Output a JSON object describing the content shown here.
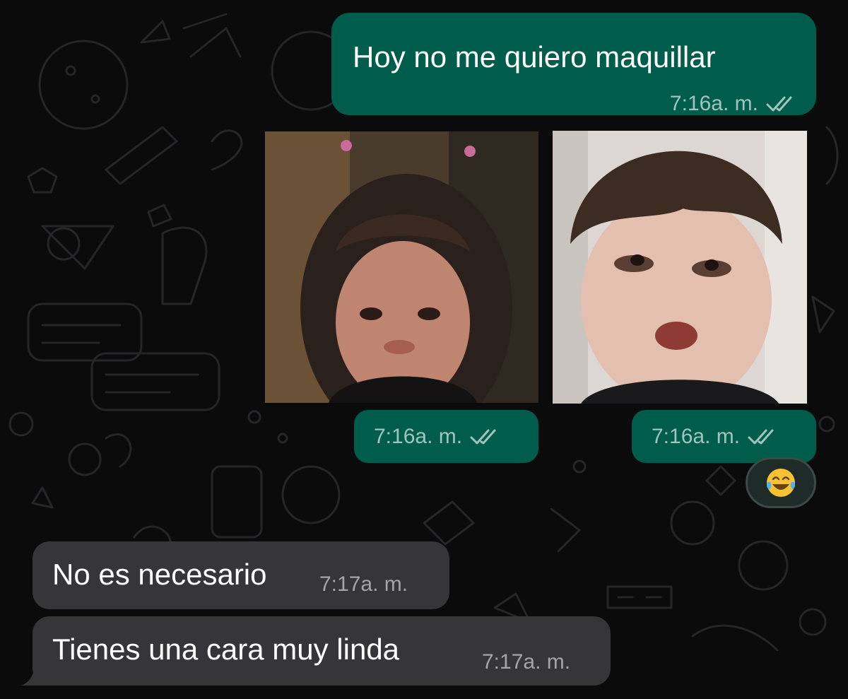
{
  "messages": {
    "m1": {
      "text": "Hoy no me quiero maquillar",
      "time": "7:16a. m."
    },
    "photo1": {
      "time": "7:16a. m."
    },
    "photo2": {
      "time": "7:16a. m."
    },
    "reaction": {
      "emoji": "😂"
    },
    "m2": {
      "text": "No es necesario",
      "time": "7:17a. m."
    },
    "m3": {
      "text": "Tienes una cara muy linda",
      "time": "7:17a. m."
    }
  },
  "colors": {
    "outgoing_bubble": "#005c4b",
    "incoming_bubble": "#363638",
    "background": "#0b0b0c",
    "read_ticks": "#9fc5bd"
  },
  "icons": [
    "double-check-icon",
    "tears-of-joy-emoji"
  ]
}
